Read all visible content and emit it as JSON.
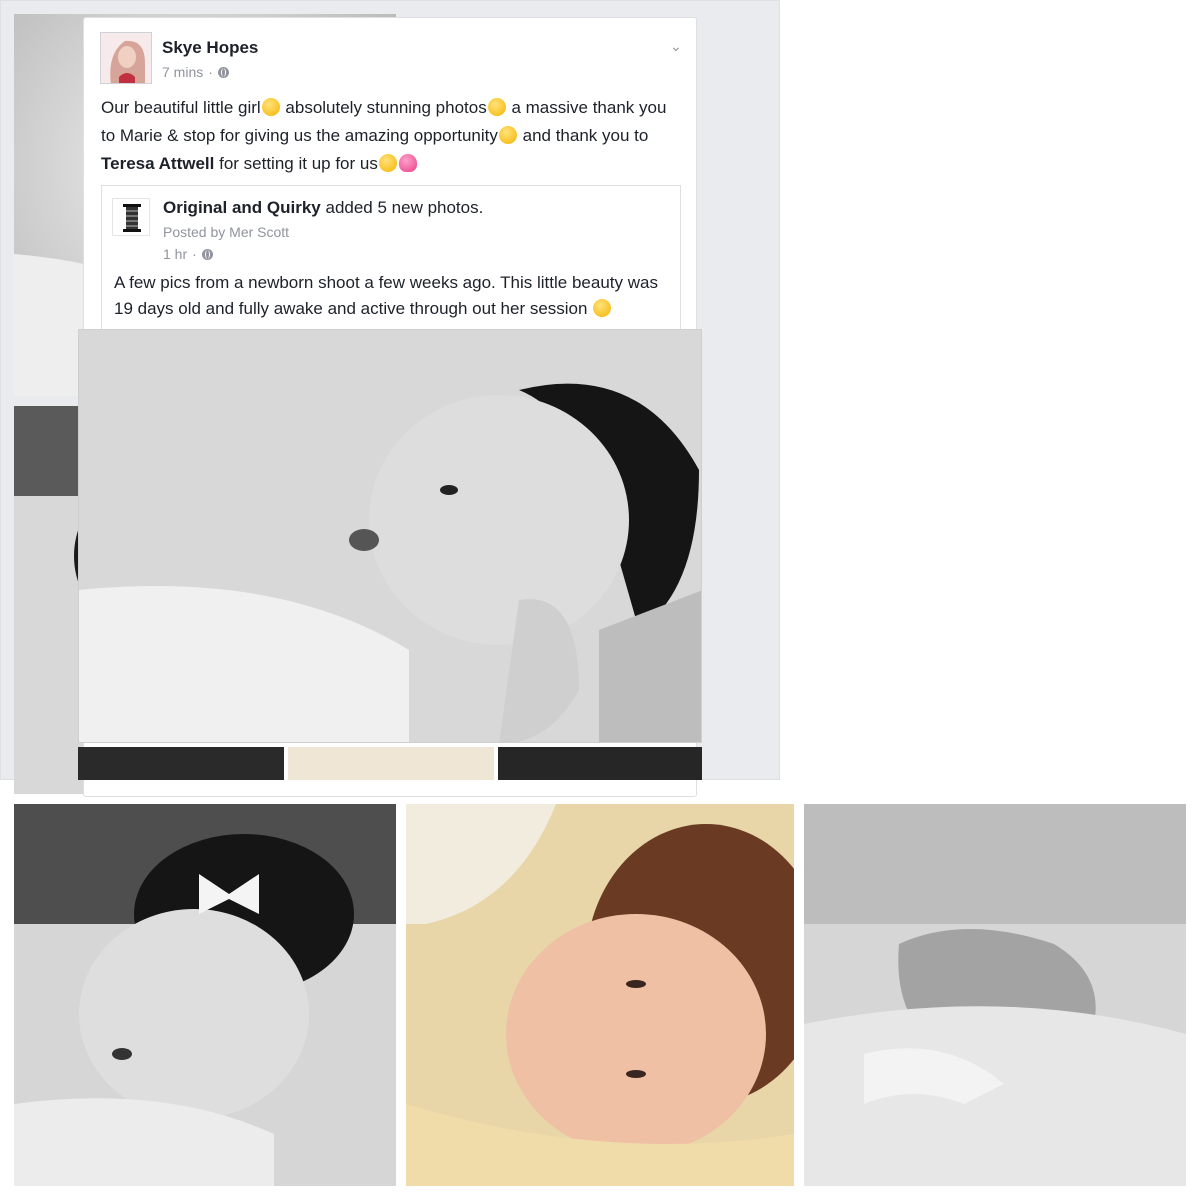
{
  "post": {
    "author": "Skye Hopes",
    "time": "7 mins",
    "separator": "·",
    "text_parts": {
      "p1": "Our beautiful little girl",
      "p2": " absolutely stunning photos",
      "p3": " a massive thank you to Marie & stop for giving us the amazing opportunity",
      "p4": " and thank you to ",
      "mention": "Teresa Attwell",
      "p5": " for setting it up for us"
    }
  },
  "shared_post": {
    "page_name": "Original and Quirky",
    "action": " added 5 new photos.",
    "posted_by": "Posted by Mer Scott",
    "time": "1 hr",
    "separator": "·",
    "text": "A few pics from a newborn shoot a few weeks ago.  This little beauty was 19 days old and fully awake and active through out her session"
  },
  "icons": {
    "globe": "globe-icon",
    "chevron": "chevron-down-icon",
    "emojis": [
      "heart-eyes-emoji",
      "grin-emoji",
      "smile-emoji",
      "kiss-emoji",
      "heart-emoji",
      "wink-emoji"
    ]
  },
  "colors": {
    "text": "#1d2129",
    "meta": "#90949c",
    "feed_bg": "#e9ebee",
    "card_border": "#dddfe2",
    "emoji_face": "#f5b400",
    "emoji_heart": "#e8408a"
  }
}
